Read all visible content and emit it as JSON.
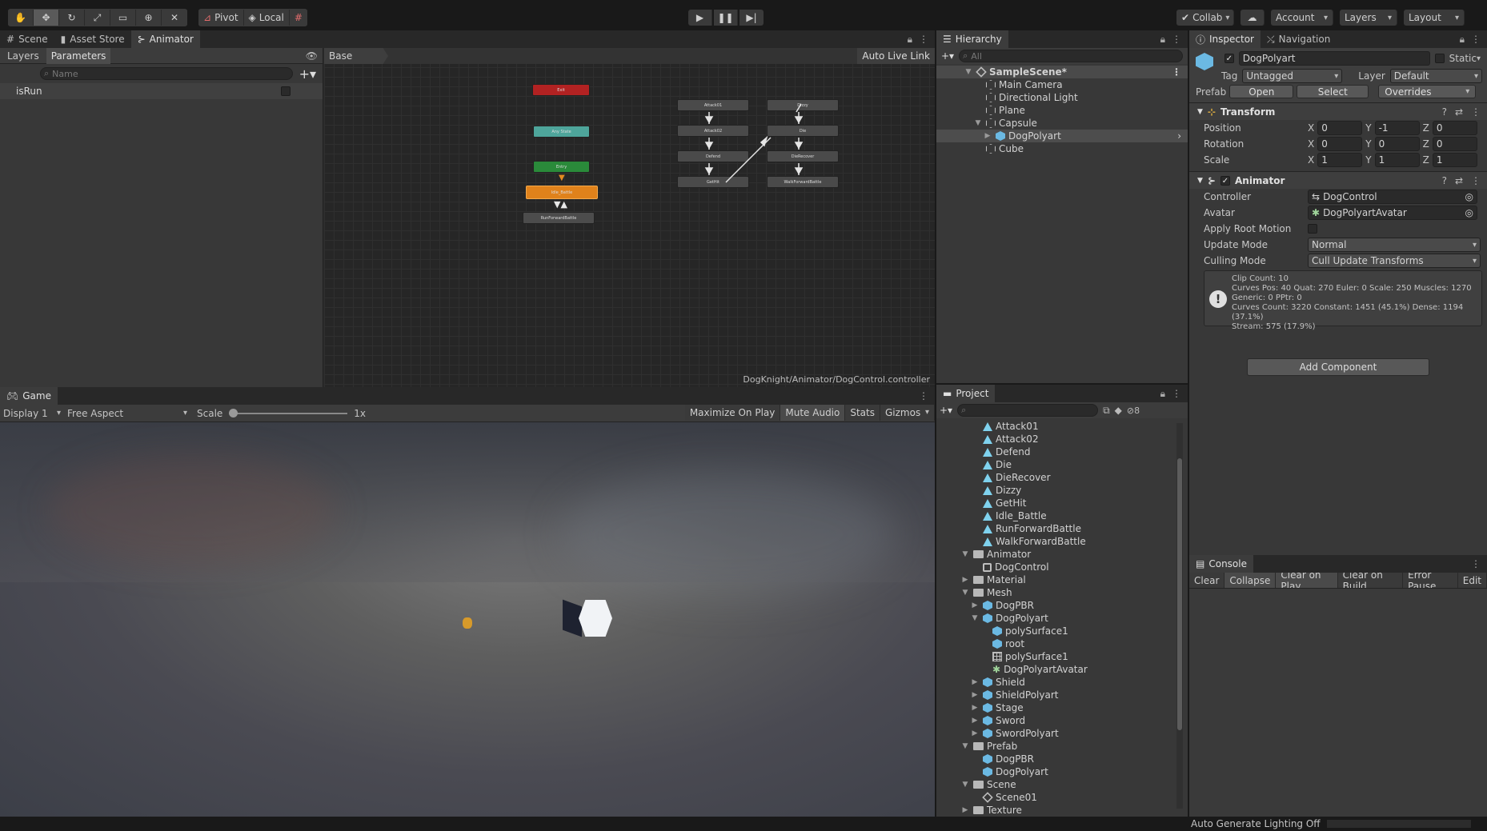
{
  "toolbar": {
    "pivot": "Pivot",
    "local": "Local",
    "collab": "Collab",
    "account": "Account",
    "layers": "Layers",
    "layout": "Layout"
  },
  "top_tabs": {
    "scene": "Scene",
    "asset_store": "Asset Store",
    "animator": "Animator"
  },
  "animator": {
    "sub_tabs": [
      "Layers",
      "Parameters"
    ],
    "search_placeholder": "Name",
    "param_name": "isRun",
    "breadcrumb": "Base Layer",
    "auto_live_link": "Auto Live Link",
    "path": "DogKnight/Animator/DogControl.controller",
    "states": {
      "exit": "Exit",
      "any_state": "Any State",
      "entry": "Entry",
      "idle": "Idle_Battle",
      "run": "RunForwardBattle",
      "attack01": "Attack01",
      "attack02": "Attack02",
      "defend": "Defend",
      "gethit": "GetHit",
      "dizzy": "Dizzy",
      "die": "Die",
      "dierecover": "DieRecover",
      "walk": "WalkForwardBattle"
    }
  },
  "hierarchy": {
    "title": "Hierarchy",
    "search_placeholder": "All",
    "scene": "SampleScene*",
    "items": [
      "Main Camera",
      "Directional Light",
      "Plane",
      "Capsule",
      "DogPolyart",
      "Cube"
    ]
  },
  "inspector": {
    "tabs": [
      "Inspector",
      "Navigation"
    ],
    "object_name": "DogPolyart",
    "static_label": "Static",
    "tag_label": "Tag",
    "tag_value": "Untagged",
    "layer_label": "Layer",
    "layer_value": "Default",
    "prefab_label": "Prefab",
    "prefab_open": "Open",
    "prefab_select": "Select",
    "prefab_overrides": "Overrides",
    "transform": {
      "title": "Transform",
      "position_label": "Position",
      "position": [
        "0",
        "-1",
        "0"
      ],
      "rotation_label": "Rotation",
      "rotation": [
        "0",
        "0",
        "0"
      ],
      "scale_label": "Scale",
      "scale": [
        "1",
        "1",
        "1"
      ]
    },
    "animator": {
      "title": "Animator",
      "controller_label": "Controller",
      "controller": "DogControl",
      "avatar_label": "Avatar",
      "avatar": "DogPolyartAvatar",
      "apply_root_motion_label": "Apply Root Motion",
      "update_mode_label": "Update Mode",
      "update_mode": "Normal",
      "culling_mode_label": "Culling Mode",
      "culling_mode": "Cull Update Transforms",
      "info": [
        "Clip Count: 10",
        "Curves Pos: 40 Quat: 270 Euler: 0 Scale: 250 Muscles: 1270",
        "Generic: 0 PPtr: 0",
        "Curves Count: 3220 Constant: 1451 (45.1%) Dense: 1194 (37.1%)",
        "Stream: 575 (17.9%)"
      ]
    },
    "add_component": "Add Component"
  },
  "game": {
    "tab": "Game",
    "display": "Display 1",
    "aspect": "Free Aspect",
    "scale_label": "Scale",
    "scale_value": "1x",
    "maximize": "Maximize On Play",
    "mute": "Mute Audio",
    "stats": "Stats",
    "gizmos": "Gizmos"
  },
  "project": {
    "title": "Project",
    "hidden_count": "8",
    "items": [
      {
        "label": "Attack01",
        "icon": "anim",
        "indent": 4
      },
      {
        "label": "Attack02",
        "icon": "anim",
        "indent": 4
      },
      {
        "label": "Defend",
        "icon": "anim",
        "indent": 4
      },
      {
        "label": "Die",
        "icon": "anim",
        "indent": 4
      },
      {
        "label": "DieRecover",
        "icon": "anim",
        "indent": 4
      },
      {
        "label": "Dizzy",
        "icon": "anim",
        "indent": 4
      },
      {
        "label": "GetHit",
        "icon": "anim",
        "indent": 4
      },
      {
        "label": "Idle_Battle",
        "icon": "anim",
        "indent": 4
      },
      {
        "label": "RunForwardBattle",
        "icon": "anim",
        "indent": 4
      },
      {
        "label": "WalkForwardBattle",
        "icon": "anim",
        "indent": 4
      },
      {
        "label": "Animator",
        "icon": "folder",
        "indent": 3,
        "arrow": "open"
      },
      {
        "label": "DogControl",
        "icon": "ctrl",
        "indent": 4
      },
      {
        "label": "Material",
        "icon": "folder",
        "indent": 3,
        "arrow": "closed"
      },
      {
        "label": "Mesh",
        "icon": "folder",
        "indent": 3,
        "arrow": "open"
      },
      {
        "label": "DogPBR",
        "icon": "cube",
        "indent": 4,
        "arrow": "closed"
      },
      {
        "label": "DogPolyart",
        "icon": "cube",
        "indent": 4,
        "arrow": "open"
      },
      {
        "label": "polySurface1",
        "icon": "cube",
        "indent": 5
      },
      {
        "label": "root",
        "icon": "cube",
        "indent": 5
      },
      {
        "label": "polySurface1",
        "icon": "grid",
        "indent": 5
      },
      {
        "label": "DogPolyartAvatar",
        "icon": "avatar",
        "indent": 5
      },
      {
        "label": "Shield",
        "icon": "cube",
        "indent": 4,
        "arrow": "closed"
      },
      {
        "label": "ShieldPolyart",
        "icon": "cube",
        "indent": 4,
        "arrow": "closed"
      },
      {
        "label": "Stage",
        "icon": "cube",
        "indent": 4,
        "arrow": "closed"
      },
      {
        "label": "Sword",
        "icon": "cube",
        "indent": 4,
        "arrow": "closed"
      },
      {
        "label": "SwordPolyart",
        "icon": "cube",
        "indent": 4,
        "arrow": "closed"
      },
      {
        "label": "Prefab",
        "icon": "folder",
        "indent": 3,
        "arrow": "open"
      },
      {
        "label": "DogPBR",
        "icon": "cube",
        "indent": 4
      },
      {
        "label": "DogPolyart",
        "icon": "cube",
        "indent": 4
      },
      {
        "label": "Scene",
        "icon": "folder",
        "indent": 3,
        "arrow": "open"
      },
      {
        "label": "Scene01",
        "icon": "scene",
        "indent": 4
      },
      {
        "label": "Texture",
        "icon": "folder",
        "indent": 3,
        "arrow": "closed"
      }
    ]
  },
  "console": {
    "title": "Console",
    "buttons": [
      "Clear",
      "Collapse",
      "Clear on Play",
      "Clear on Build",
      "Error Pause",
      "Edit"
    ]
  },
  "status_bar": {
    "text": "Auto Generate Lighting Off"
  }
}
